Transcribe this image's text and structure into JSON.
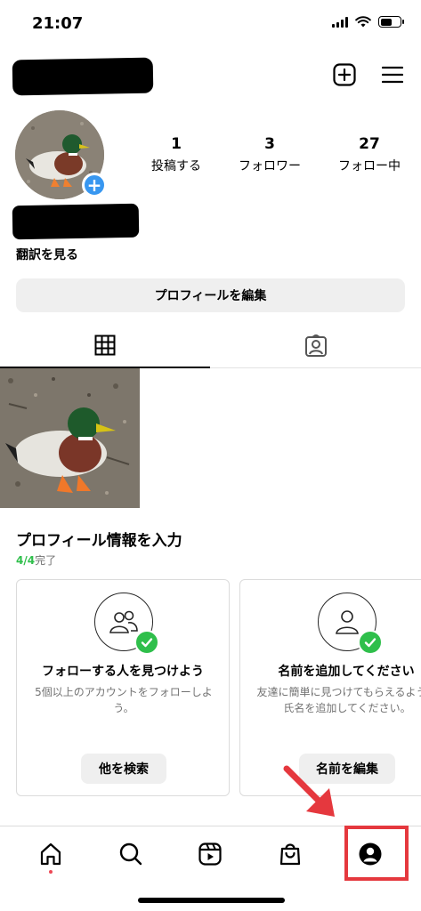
{
  "status_bar": {
    "time": "21:07",
    "battery_level": 0.6
  },
  "header": {
    "new_post_icon": "plus-square-icon",
    "menu_icon": "hamburger-menu-icon"
  },
  "profile": {
    "stats": [
      {
        "value": "1",
        "label": "投稿する"
      },
      {
        "value": "3",
        "label": "フォロワー"
      },
      {
        "value": "27",
        "label": "フォロー中"
      }
    ],
    "translate_label": "翻訳を見る",
    "edit_button": "プロフィールを編集"
  },
  "tabs": [
    {
      "icon": "grid-icon",
      "active": true
    },
    {
      "icon": "tagged-person-icon",
      "active": false
    }
  ],
  "complete_profile": {
    "title": "プロフィール情報を入力",
    "progress_done": "4/4",
    "progress_suffix": "完了",
    "cards": [
      {
        "icon": "people-icon",
        "title": "フォローする人を見つけよう",
        "description": "5個以上のアカウントをフォローしよう。",
        "button": "他を検索",
        "checked": true
      },
      {
        "icon": "person-icon",
        "title": "名前を追加してください",
        "description": "友達に簡単に見つけてもらえるよう、氏名を追加してください。",
        "button": "名前を編集",
        "checked": true
      }
    ]
  },
  "bottom_nav": [
    {
      "icon": "home-icon",
      "notification_dot": true
    },
    {
      "icon": "search-icon"
    },
    {
      "icon": "reels-icon"
    },
    {
      "icon": "shop-bag-icon"
    },
    {
      "icon": "profile-icon",
      "active": true
    }
  ],
  "colors": {
    "accent_blue": "#3897f0",
    "check_green": "#2fbf4b",
    "highlight_red": "#e5383e",
    "button_gray": "#efefef"
  }
}
